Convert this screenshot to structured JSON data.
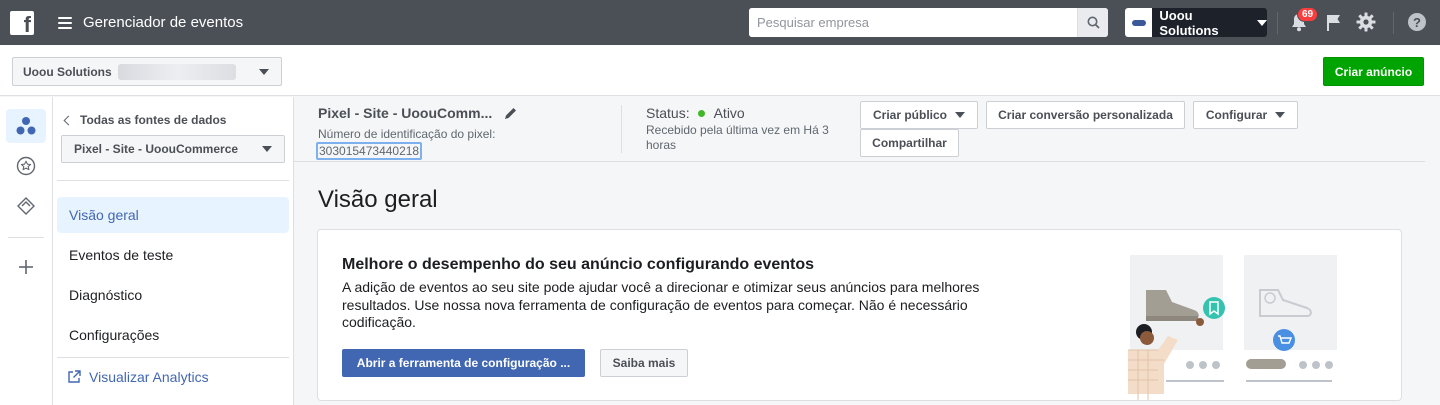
{
  "topbar": {
    "app_title": "Gerenciador de eventos",
    "search_placeholder": "Pesquisar empresa",
    "account_name": "Uoou Solutions",
    "notifications_count": "69",
    "help_label": "?"
  },
  "subheader": {
    "business_name": "Uoou Solutions",
    "create_ad_label": "Criar anúncio"
  },
  "leftnav": {
    "back_label": "Todas as fontes de dados",
    "pixel_selected": "Pixel - Site - UoouCommerce",
    "items": [
      {
        "label": "Visão geral",
        "active": true
      },
      {
        "label": "Eventos de teste",
        "active": false
      },
      {
        "label": "Diagnóstico",
        "active": false
      },
      {
        "label": "Configurações",
        "active": false
      }
    ],
    "external_link": "Visualizar Analytics"
  },
  "pixel_header": {
    "name": "Pixel - Site - UoouComm...",
    "id_label": "Número de identificação do pixel:",
    "id_value": "303015473440218",
    "status_label": "Status:",
    "status_value": "Ativo",
    "status_color": "#42b72a",
    "status_sub": "Recebido pela última vez em Há 3 horas",
    "buttons": {
      "create_audience": "Criar público",
      "custom_conversion": "Criar conversão personalizada",
      "configure": "Configurar",
      "share": "Compartilhar"
    }
  },
  "main": {
    "title": "Visão geral",
    "card": {
      "title": "Melhore o desempenho do seu anúncio configurando eventos",
      "text": "A adição de eventos ao seu site pode ajudar você a direcionar e otimizar seus anúncios para melhores resultados. Use nossa nova ferramenta de configuração de eventos para começar. Não é necessário codificação.",
      "primary_button": "Abrir a ferramenta de configuração ...",
      "secondary_button": "Saiba mais"
    }
  },
  "colors": {
    "topbar": "#4b4f56",
    "accent": "#4267b2",
    "create_ad": "#00a400",
    "badge": "#fa3e3e"
  }
}
